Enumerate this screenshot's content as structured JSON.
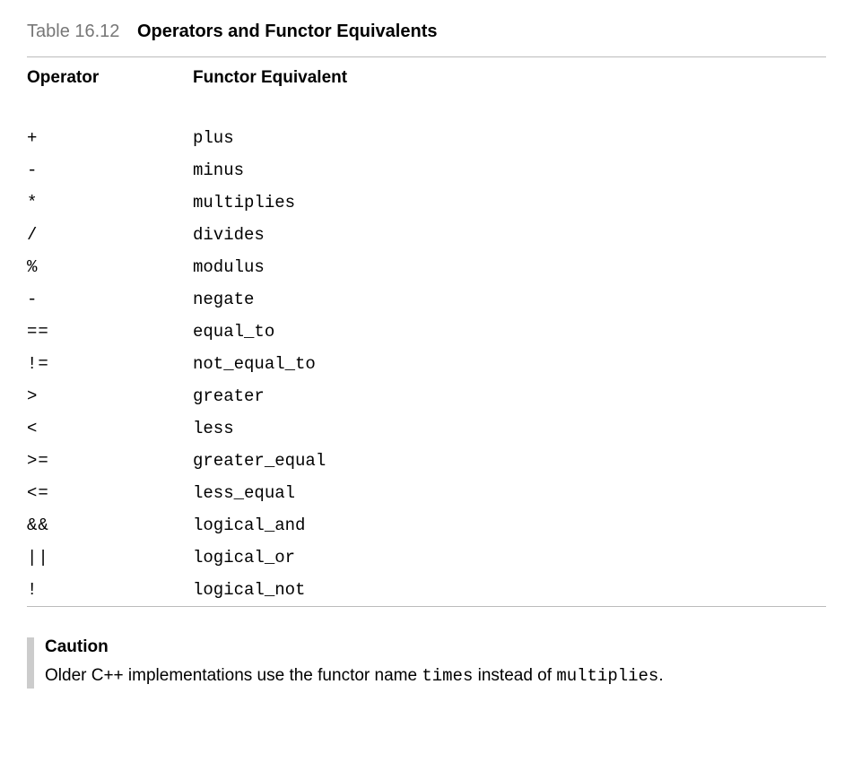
{
  "table": {
    "number": "Table 16.12",
    "title": "Operators and Functor Equivalents",
    "headers": {
      "operator": "Operator",
      "functor": "Functor Equivalent"
    },
    "rows": [
      {
        "operator": "+",
        "functor": "plus"
      },
      {
        "operator": "-",
        "functor": "minus"
      },
      {
        "operator": "*",
        "functor": "multiplies"
      },
      {
        "operator": "/",
        "functor": "divides"
      },
      {
        "operator": "%",
        "functor": "modulus"
      },
      {
        "operator": "-",
        "functor": "negate"
      },
      {
        "operator": "==",
        "functor": "equal_to"
      },
      {
        "operator": "!=",
        "functor": "not_equal_to"
      },
      {
        "operator": ">",
        "functor": "greater"
      },
      {
        "operator": "<",
        "functor": "less"
      },
      {
        "operator": ">=",
        "functor": "greater_equal"
      },
      {
        "operator": "<=",
        "functor": "less_equal"
      },
      {
        "operator": "&&",
        "functor": "logical_and"
      },
      {
        "operator": "||",
        "functor": "logical_or"
      },
      {
        "operator": "!",
        "functor": "logical_not"
      }
    ]
  },
  "caution": {
    "title": "Caution",
    "text_pre": "Older C++ implementations use the functor name ",
    "code1": "times",
    "text_mid": " instead of ",
    "code2": "multiplies",
    "text_post": "."
  }
}
